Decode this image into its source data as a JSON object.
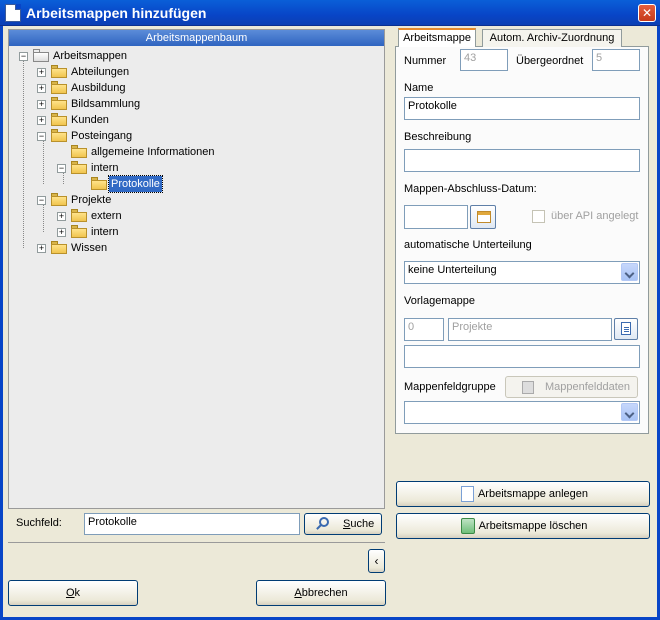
{
  "window": {
    "title": "Arbeitsmappen hinzufügen",
    "close_glyph": "✕"
  },
  "tree": {
    "header": "Arbeitsmappenbaum",
    "nodes": [
      {
        "label": "Arbeitsmappen",
        "expander": "−",
        "icon": "folder-open-icon"
      },
      {
        "label": "Abteilungen",
        "expander": "+",
        "icon": "folder-icon"
      },
      {
        "label": "Ausbildung",
        "expander": "+",
        "icon": "folder-icon"
      },
      {
        "label": "Bildsammlung",
        "expander": "+",
        "icon": "folder-icon"
      },
      {
        "label": "Kunden",
        "expander": "+",
        "icon": "folder-icon"
      },
      {
        "label": "Posteingang",
        "expander": "−",
        "icon": "folder-open-icon"
      },
      {
        "label": "allgemeine Informationen",
        "expander": "",
        "icon": "folder-icon"
      },
      {
        "label": "intern",
        "expander": "−",
        "icon": "folder-open-icon"
      },
      {
        "label": "Protokolle",
        "expander": "",
        "icon": "folder-selected-icon",
        "selected": true
      },
      {
        "label": "Projekte",
        "expander": "−",
        "icon": "folder-open-icon"
      },
      {
        "label": "extern",
        "expander": "+",
        "icon": "folder-icon"
      },
      {
        "label": "intern",
        "expander": "+",
        "icon": "folder-icon"
      },
      {
        "label": "Wissen",
        "expander": "+",
        "icon": "folder-icon"
      }
    ]
  },
  "search": {
    "label": "Suchfeld:",
    "value": "Protokolle",
    "button_label_prefix": "S",
    "button_label_rest": "uche"
  },
  "footer": {
    "ok_accel": "O",
    "ok_rest": "k",
    "cancel_accel": "A",
    "cancel_rest": "bbrechen",
    "collapse_glyph": "‹"
  },
  "tabs": {
    "active": "Arbeitsmappe",
    "other": "Autom. Archiv-Zuordnung"
  },
  "form": {
    "nummer_label": "Nummer",
    "nummer_value": "43",
    "uebergeordnet_label": "Übergeordnet",
    "uebergeordnet_value": "5",
    "name_label": "Name",
    "name_value": "Protokolle",
    "beschreibung_label": "Beschreibung",
    "beschreibung_value": "",
    "abschluss_label": "Mappen-Abschluss-Datum:",
    "abschluss_value": "",
    "api_label": "über API angelegt",
    "unterteilung_label": "automatische Unterteilung",
    "unterteilung_value": "keine Unterteilung",
    "vorlage_label": "Vorlagemappe",
    "vorlage_number": "0",
    "vorlage_name": "Projekte",
    "vorlage_extra": "",
    "feldgruppe_label": "Mappenfeldgruppe",
    "feldgruppe_value": "",
    "mappenfelddaten_label": "Mappenfelddaten"
  },
  "actions": {
    "anlegen": "Arbeitsmappe anlegen",
    "loeschen": "Arbeitsmappe löschen"
  },
  "colors": {
    "titlebar": "#0845c7",
    "tree_header": "#2f64c0",
    "selection": "#316ac5",
    "face": "#ece9d8"
  }
}
